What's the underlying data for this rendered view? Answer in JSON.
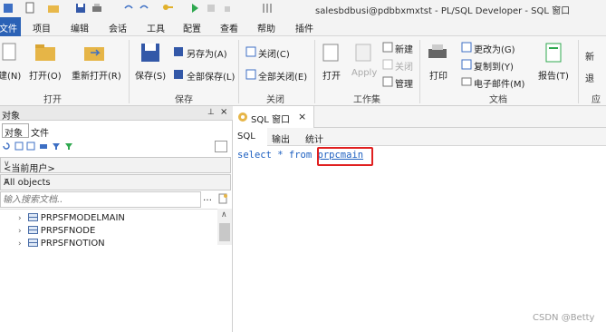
{
  "window": {
    "title": "salesbdbusi@pdbbxmxtst - PL/SQL Developer - SQL 窗口"
  },
  "menubar": {
    "items": [
      "文件",
      "项目",
      "编辑",
      "会话",
      "工具",
      "配置",
      "查看",
      "帮助",
      "插件"
    ]
  },
  "ribbon": {
    "groups": {
      "open": "打开",
      "save": "保存",
      "close": "关闭",
      "toolset": "工作集",
      "doc": "文档"
    },
    "buttons": {
      "new": "建(N)",
      "open": "打开(O)",
      "reopen": "重新打开(R)",
      "save": "保存(S)",
      "save_as": "另存为(A)",
      "save_all": "全部保存(L)",
      "close": "关闭(C)",
      "close_all": "全部关闭(E)",
      "ws_open": "打开",
      "ws_apply": "Apply",
      "ws_new": "新建",
      "ws_close": "关闭",
      "ws_manage": "管理",
      "print": "打印",
      "change_to": "更改为(G)",
      "copy_to": "复制到(Y)",
      "email": "电子邮件(M)",
      "report": "报告(T)",
      "extra_new": "新",
      "extra_back": "退",
      "extra_app": "应"
    }
  },
  "left_panel": {
    "header": "对象",
    "tabs": [
      "对象",
      "文件"
    ],
    "user_combo": "<当前用户>",
    "filter_combo": "All objects",
    "search_placeholder": "输入搜索文档..",
    "tree_items": [
      "PRPSFMODELMAIN",
      "PRPSFNODE",
      "PRPSFNOTION"
    ]
  },
  "editor": {
    "tab_title": "SQL 窗口",
    "subtabs": [
      "SQL",
      "输出",
      "统计"
    ],
    "code_prefix": "select * from ",
    "code_highlight": "prpcmain"
  },
  "watermark": "CSDN @Betty",
  "colors": {
    "accent": "#2b62b6",
    "highlight_box": "#e02020",
    "code": "#1c5fc0"
  }
}
